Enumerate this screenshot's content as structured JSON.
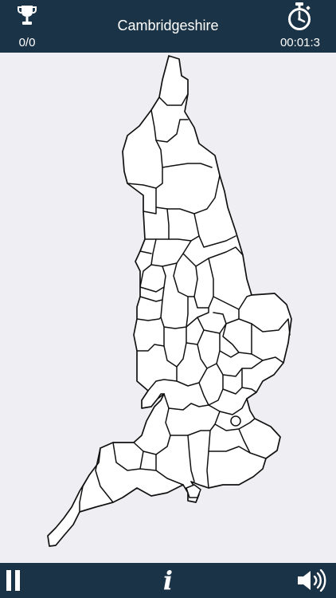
{
  "header": {
    "target_county": "Cambridgeshire",
    "score": "0/0",
    "timer": "00:01:3",
    "trophy_icon": "trophy-icon",
    "stopwatch_icon": "stopwatch-icon"
  },
  "map": {
    "subject": "england-counties-outline",
    "fill_color": "#ffffff",
    "border_color": "#111111"
  },
  "footer": {
    "pause_icon": "pause-icon",
    "info_label": "i",
    "sound_icon": "speaker-icon"
  },
  "colors": {
    "bar": "#1b3346",
    "background": "#efeef3",
    "text_on_bar": "#ffffff"
  }
}
